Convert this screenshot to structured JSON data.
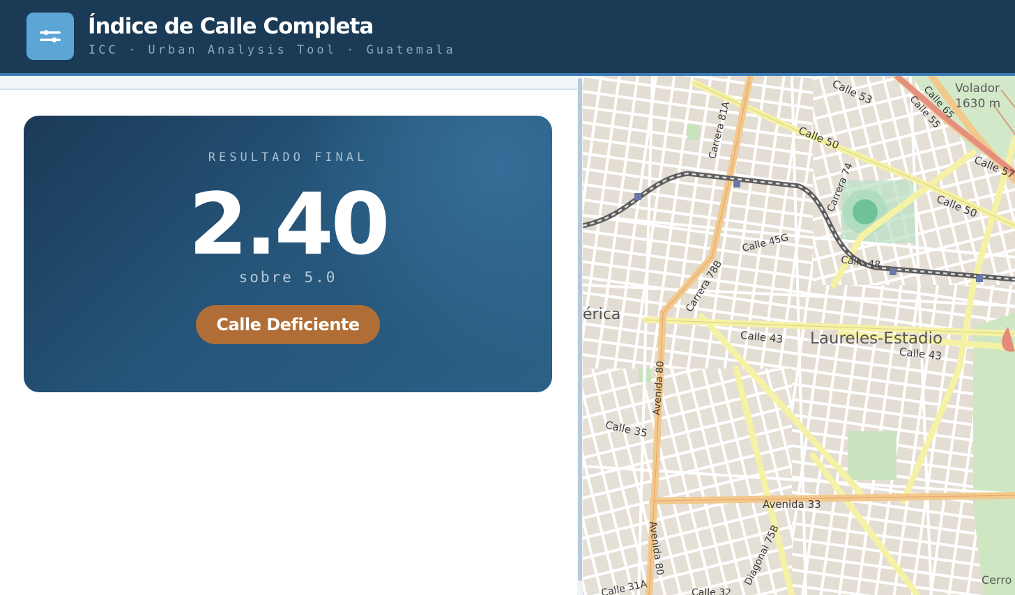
{
  "header": {
    "title": "Índice de Calle Completa",
    "subtitle": "ICC · Urban Analysis Tool · Guatemala",
    "menu_icon": "sliders-icon"
  },
  "result": {
    "label": "RESULTADO FINAL",
    "score": "2.40",
    "scale": "sobre 5.0",
    "badge": "Calle Deficiente",
    "score_value": 2.4,
    "max_value": 5.0
  },
  "map": {
    "labels": [
      {
        "id": "calle-53",
        "text": "Calle 53"
      },
      {
        "id": "calle-65",
        "text": "Calle 65"
      },
      {
        "id": "calle-55",
        "text": "Calle 55"
      },
      {
        "id": "volador",
        "text": "Volador"
      },
      {
        "id": "volador-elev",
        "text": "1630 m"
      },
      {
        "id": "calle-50a",
        "text": "Calle 50"
      },
      {
        "id": "calle-57",
        "text": "Calle 57"
      },
      {
        "id": "carrera-81a",
        "text": "Carrera 81A"
      },
      {
        "id": "carrera-74",
        "text": "Carrera 74"
      },
      {
        "id": "calle-50b",
        "text": "Calle 50"
      },
      {
        "id": "calle-45g",
        "text": "Calle 45G"
      },
      {
        "id": "calle-48",
        "text": "Calle 48"
      },
      {
        "id": "carrera-78b",
        "text": "Carrera 78B"
      },
      {
        "id": "erica",
        "text": "érica"
      },
      {
        "id": "calle-43a",
        "text": "Calle 43"
      },
      {
        "id": "laureles",
        "text": "Laureles-Estadio"
      },
      {
        "id": "calle-43b",
        "text": "Calle 43"
      },
      {
        "id": "avenida-80a",
        "text": "Avenida 80"
      },
      {
        "id": "calle-35",
        "text": "Calle 35"
      },
      {
        "id": "avenida-33",
        "text": "Avenida 33"
      },
      {
        "id": "avenida-80b",
        "text": "Avenida 80"
      },
      {
        "id": "diagonal-75b",
        "text": "Diagonal 75B"
      },
      {
        "id": "calle-31a",
        "text": "Calle 31A"
      },
      {
        "id": "calle-32",
        "text": "Calle 32"
      },
      {
        "id": "cerro",
        "text": "Cerro"
      }
    ]
  }
}
